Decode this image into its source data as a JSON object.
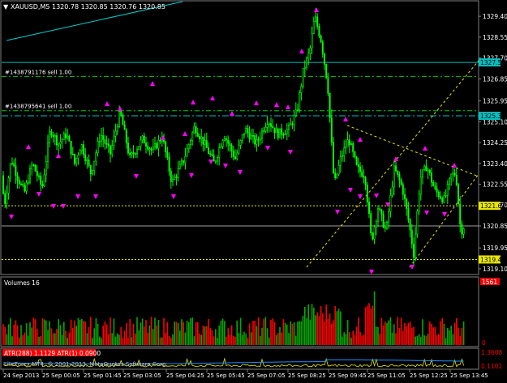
{
  "chart_data": [
    {
      "type": "candlestick",
      "title": "XAUUSD,M5  1320.78 1320.85 1320.76 1320.85",
      "symbol_marker": "▼",
      "ylim": [
        1318.9,
        1330.0
      ],
      "yticks": [
        "1329.40",
        "1328.55",
        "1327.70",
        "1326.85",
        "1325.95",
        "1325.10",
        "1324.25",
        "1323.40",
        "1322.55",
        "1321.70",
        "1320.85",
        "1319.95",
        "1319.10"
      ],
      "price_labels": [
        {
          "label": "1327.52",
          "value": 1327.52,
          "color": "#00bfbf"
        },
        {
          "label": "1325.34",
          "value": 1325.34,
          "color": "#00bfbf"
        },
        {
          "label": "1321.67",
          "value": 1321.67,
          "color": "#e8e800"
        },
        {
          "label": "1319.48",
          "value": 1319.48,
          "color": "#e8e800"
        }
      ],
      "order_lines": [
        {
          "label": "#1438791176 sell 1.00",
          "value": 1326.95
        },
        {
          "label": "#1438795641 sell 1.00",
          "value": 1325.55
        }
      ],
      "bullish_color": "#00ff00",
      "bearish_color": "#00ff00",
      "fractal_color": "#ff00ff"
    },
    {
      "type": "bar",
      "title": "Volumes 16",
      "yticks": [
        "1561",
        "0"
      ],
      "colors": {
        "up": "#00aa00",
        "down": "#ff0000"
      }
    },
    {
      "type": "line",
      "title": "ATR(288) 1.1129  ATR(1) 0.0900",
      "yticks": [
        "1.3608",
        "0.1101"
      ],
      "series": [
        {
          "name": "ATR(288)",
          "color": "#1e90ff"
        },
        {
          "name": "ATR(1)",
          "color": "#e8e800"
        }
      ]
    }
  ],
  "copyright": "LiteForex MT4, © 2001-2013, MetaQuotes Software Corp.",
  "xticks": [
    "24 Sep 2013",
    "25 Sep 00:05",
    "25 Sep 01:45",
    "25 Sep 03:05",
    "25 Sep 04:25",
    "25 Sep 05:45",
    "25 Sep 07:05",
    "25 Sep 08:25",
    "25 Sep 09:45",
    "25 Sep 11:05",
    "25 Sep 12:25",
    "25 Sep 13:45"
  ]
}
